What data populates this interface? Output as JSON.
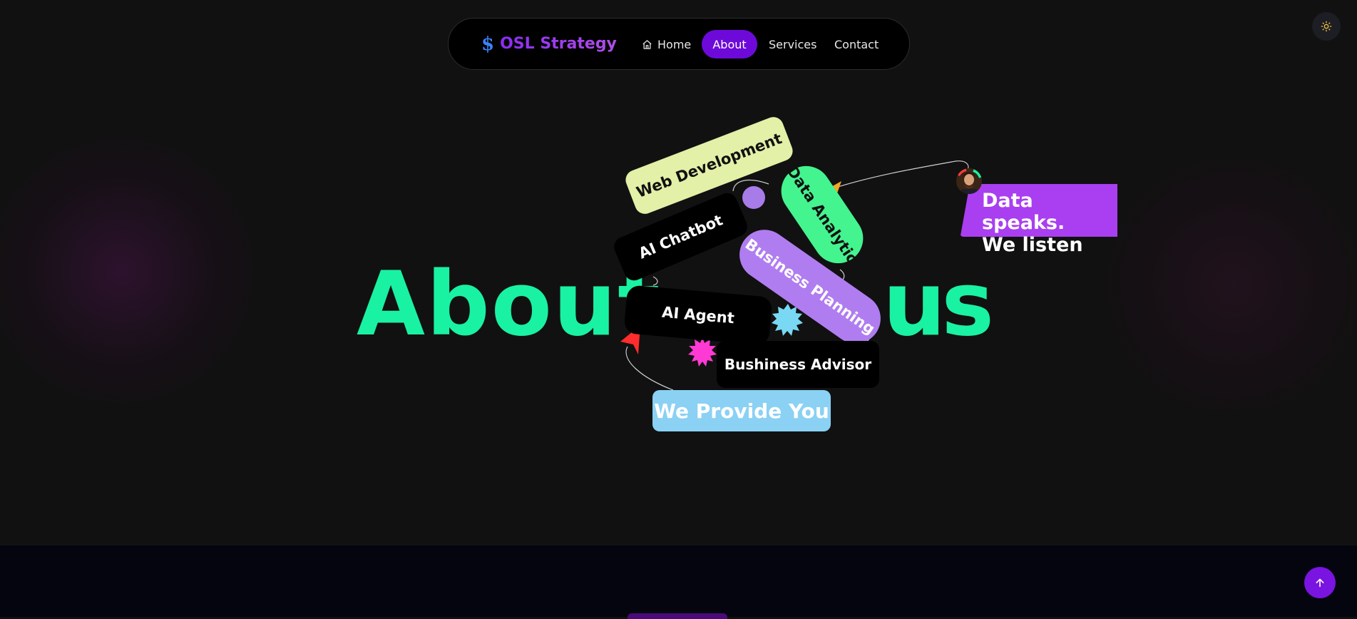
{
  "nav": {
    "brand_mark": "$",
    "brand_name": "OSL Strategy",
    "items": [
      {
        "label": "Home",
        "icon": "home-icon"
      },
      {
        "label": "About",
        "active": true
      },
      {
        "label": "Services"
      },
      {
        "label": "Contact"
      }
    ]
  },
  "theme_toggle": {
    "icon": "sun-icon"
  },
  "hero": {
    "word_left": "About",
    "word_right": "us",
    "pills": {
      "web": "Web Development",
      "chatbot": "AI Chatbot",
      "data": "Data Analytic",
      "planning": "Business Planning",
      "agent": "AI Agent",
      "advisor": "Bushiness Advisor",
      "provide": "We Provide You"
    },
    "bubble": {
      "line1": "Data speaks.",
      "line2": "We listen"
    }
  },
  "scroll_top": {
    "icon": "arrow-up-icon"
  },
  "colors": {
    "accent_green": "#19f2a2",
    "nav_active": "#6d0ad9",
    "bubble_purple": "#a93ff0",
    "background": "#111111"
  }
}
